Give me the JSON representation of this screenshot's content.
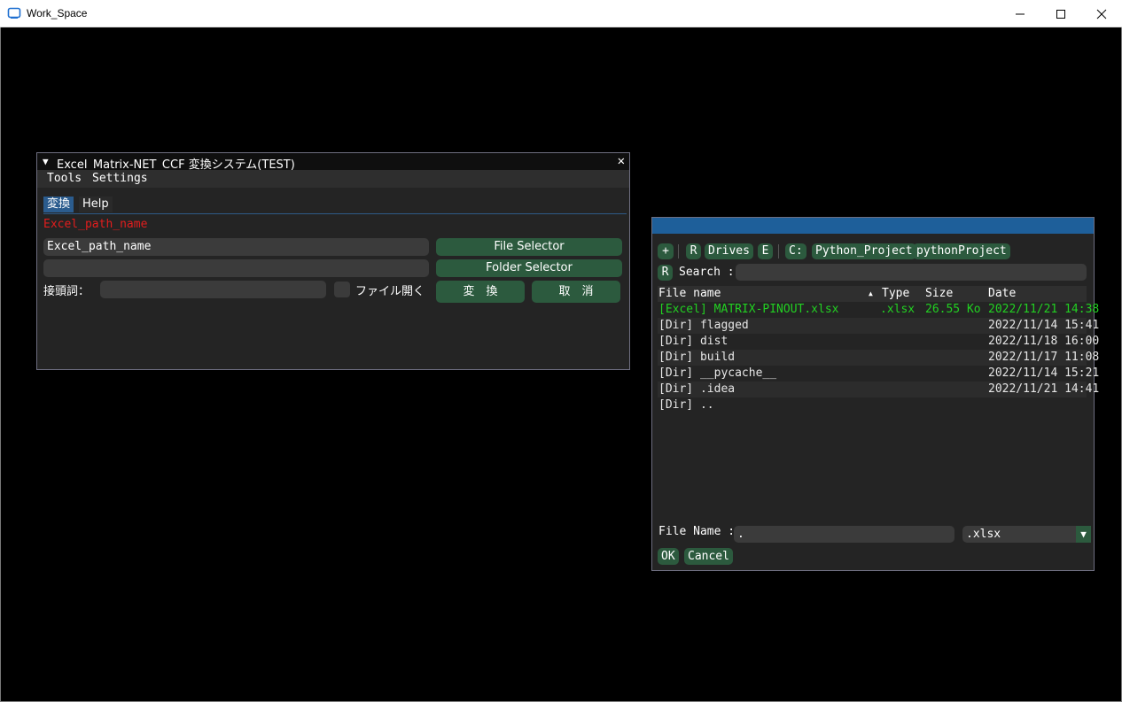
{
  "os": {
    "title": "Work_Space"
  },
  "win1": {
    "title": "Excel_Matrix-NET_CCF 変換システム(TEST)",
    "menu": [
      "Tools",
      "Settings"
    ],
    "tabs": [
      {
        "label": "変換"
      },
      {
        "label": "Help"
      }
    ],
    "path_label": "Excel_path_name",
    "path_input_value": "Excel_path_name",
    "folder_input_value": "",
    "file_selector_label": "File Selector",
    "folder_selector_label": "Folder Selector",
    "prefix_label": "接頭詞：",
    "prefix_value": "",
    "open_file_label": "ファイル開く",
    "convert_label": "変　換",
    "cancel_label": "取　消"
  },
  "file_dialog": {
    "nav": [
      "+",
      "R",
      "Drives",
      "E",
      "C:",
      "Python_Project",
      "pythonProject"
    ],
    "search_reset": "R",
    "search_label": "Search :",
    "search_value": "",
    "columns": {
      "name": "File name",
      "type": "Type",
      "size": "Size",
      "date": "Date",
      "sort_indicator": "▲"
    },
    "rows": [
      {
        "name": "[Excel] MATRIX-PINOUT.xlsx",
        "type": ".xlsx",
        "size": "26.55 Ko",
        "date": "2022/11/21 14:38"
      },
      {
        "name": "[Dir] flagged",
        "type": "",
        "size": "",
        "date": "2022/11/14 15:41"
      },
      {
        "name": "[Dir] dist",
        "type": "",
        "size": "",
        "date": "2022/11/18 16:00"
      },
      {
        "name": "[Dir] build",
        "type": "",
        "size": "",
        "date": "2022/11/17 11:08"
      },
      {
        "name": "[Dir] __pycache__",
        "type": "",
        "size": "",
        "date": "2022/11/14 15:21"
      },
      {
        "name": "[Dir] .idea",
        "type": "",
        "size": "",
        "date": "2022/11/21 14:41"
      },
      {
        "name": "[Dir] ..",
        "type": "",
        "size": "",
        "date": ""
      }
    ],
    "filename_label": "File Name :",
    "filename_value": ".",
    "filter_value": ".xlsx",
    "ok_label": "OK",
    "cancel_label": "Cancel"
  }
}
